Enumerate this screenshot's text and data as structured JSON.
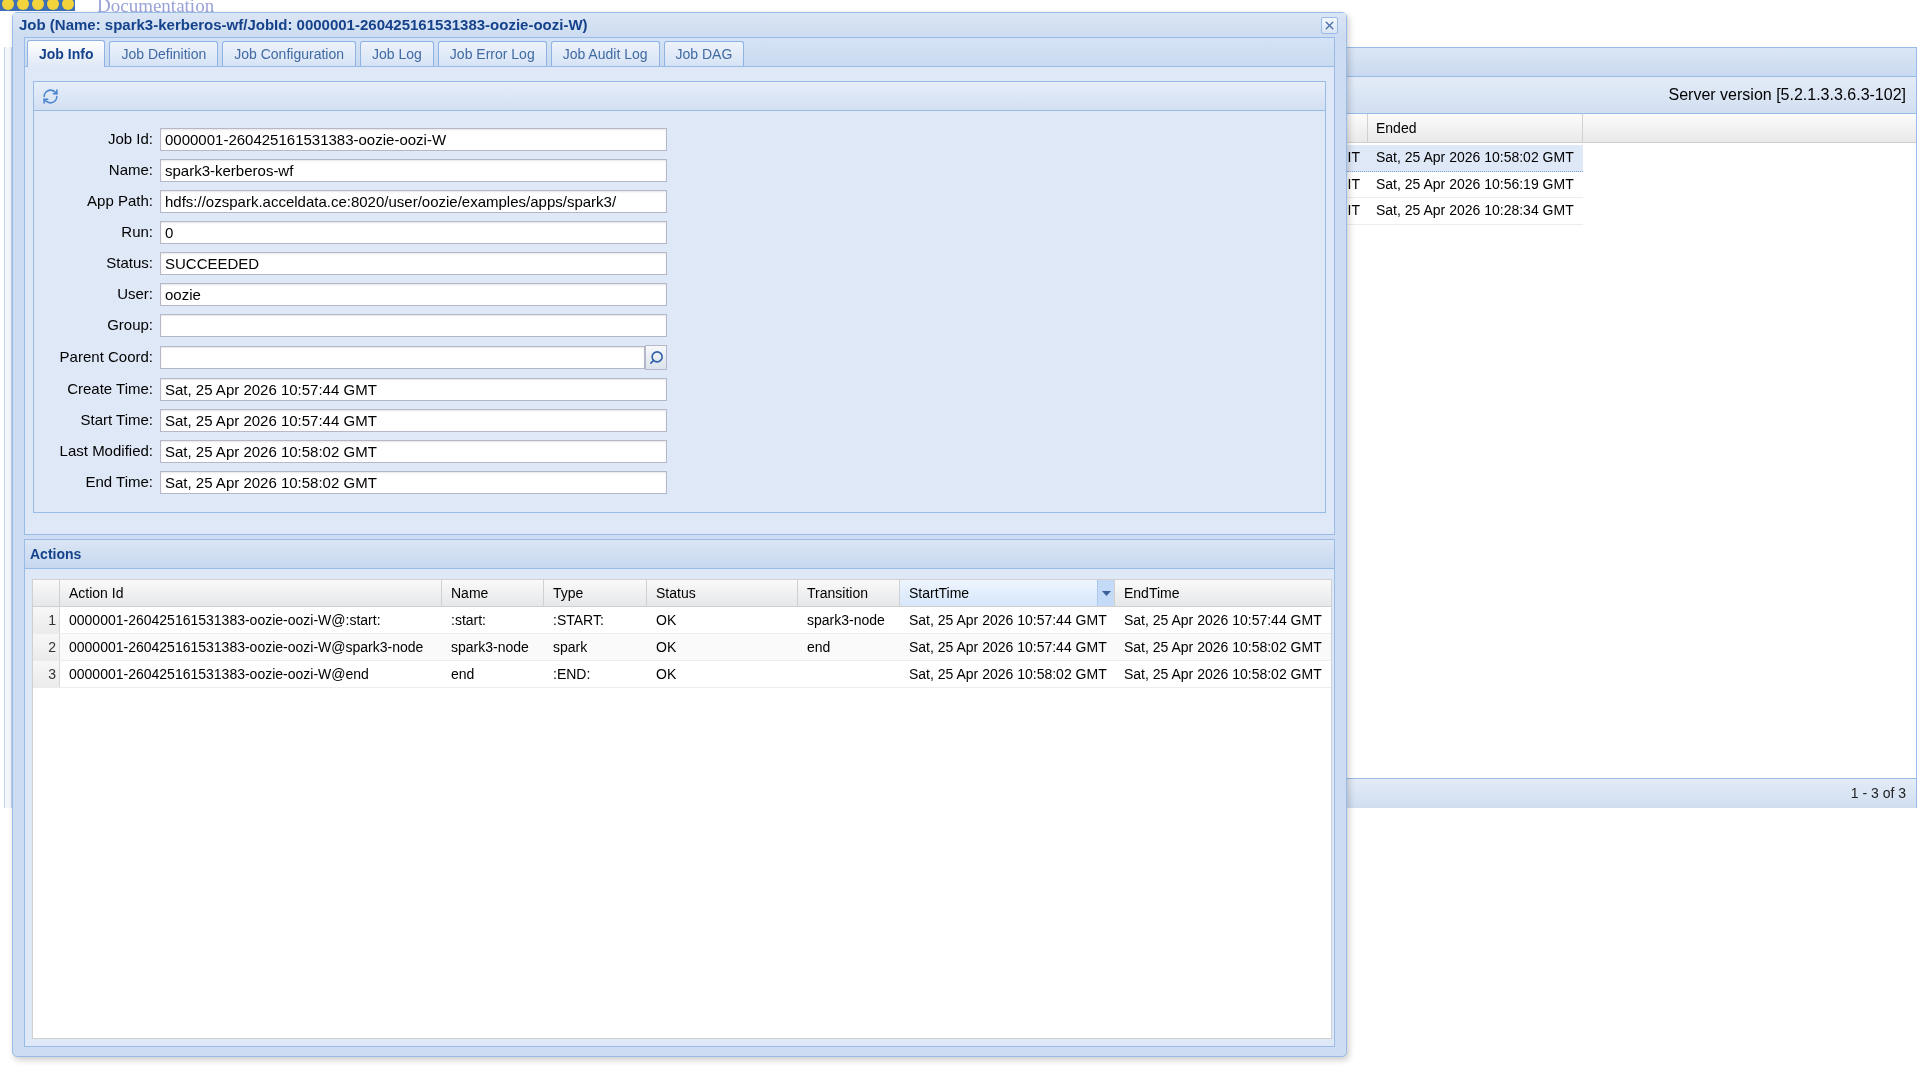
{
  "page_header": {
    "link": "Documentation"
  },
  "background_panel": {
    "server_version": "Server version [5.2.1.3.3.6.3-102]",
    "grid": {
      "ended_column": "Ended",
      "rows": [
        {
          "column_1": "IT",
          "ended": "Sat, 25 Apr 2026 10:58:02 GMT",
          "selected": true
        },
        {
          "column_1": "IT",
          "ended": "Sat, 25 Apr 2026 10:56:19 GMT",
          "selected": false
        },
        {
          "column_1": "IT",
          "ended": "Sat, 25 Apr 2026 10:28:34 GMT",
          "selected": false
        }
      ]
    },
    "paging": "1 - 3 of 3"
  },
  "dialog": {
    "title": "Job (Name: spark3-kerberos-wf/JobId: 0000001-260425161531383-oozie-oozi-W)",
    "tabs": [
      {
        "label": "Job Info",
        "selected": true
      },
      {
        "label": "Job Definition",
        "selected": false
      },
      {
        "label": "Job Configuration",
        "selected": false
      },
      {
        "label": "Job Log",
        "selected": false
      },
      {
        "label": "Job Error Log",
        "selected": false
      },
      {
        "label": "Job Audit Log",
        "selected": false
      },
      {
        "label": "Job DAG",
        "selected": false
      }
    ],
    "job_info": {
      "fields": [
        {
          "label": "Job Id:",
          "value": "0000001-260425161531383-oozie-oozi-W",
          "kind": "text"
        },
        {
          "label": "Name:",
          "value": "spark3-kerberos-wf",
          "kind": "text"
        },
        {
          "label": "App Path:",
          "value": "hdfs://ozspark.acceldata.ce:8020/user/oozie/examples/apps/spark3/",
          "kind": "text"
        },
        {
          "label": "Run:",
          "value": "0",
          "kind": "text"
        },
        {
          "label": "Status:",
          "value": "SUCCEEDED",
          "kind": "text"
        },
        {
          "label": "User:",
          "value": "oozie",
          "kind": "text"
        },
        {
          "label": "Group:",
          "kind": "text"
        },
        {
          "label": "Parent Coord:",
          "kind": "lookup"
        },
        {
          "label": "Create Time:",
          "value": "Sat, 25 Apr 2026 10:57:44 GMT",
          "kind": "text"
        },
        {
          "label": "Start Time:",
          "value": "Sat, 25 Apr 2026 10:57:44 GMT",
          "kind": "text"
        },
        {
          "label": "Last Modified:",
          "value": "Sat, 25 Apr 2026 10:58:02 GMT",
          "kind": "text"
        },
        {
          "label": "End Time:",
          "value": "Sat, 25 Apr 2026 10:58:02 GMT",
          "kind": "text"
        }
      ]
    },
    "actions": {
      "title": "Actions",
      "columns": [
        {
          "label": "Action Id",
          "highlighted": false
        },
        {
          "label": "Name",
          "highlighted": false
        },
        {
          "label": "Type",
          "highlighted": false
        },
        {
          "label": "Status",
          "highlighted": false
        },
        {
          "label": "Transition",
          "highlighted": false
        },
        {
          "label": "StartTime",
          "highlighted": true
        },
        {
          "label": "EndTime",
          "highlighted": false
        }
      ],
      "rows": [
        {
          "number": "1",
          "action_id": "0000001-260425161531383-oozie-oozi-W@:start:",
          "name": ":start:",
          "type": ":START:",
          "status": "OK",
          "transition": "spark3-node",
          "start_time": "Sat, 25 Apr 2026 10:57:44 GMT",
          "end_time": "Sat, 25 Apr 2026 10:57:44 GMT"
        },
        {
          "number": "2",
          "action_id": "0000001-260425161531383-oozie-oozi-W@spark3-node",
          "name": "spark3-node",
          "type": "spark",
          "status": "OK",
          "transition": "end",
          "start_time": "Sat, 25 Apr 2026 10:57:44 GMT",
          "end_time": "Sat, 25 Apr 2026 10:58:02 GMT"
        },
        {
          "number": "3",
          "action_id": "0000001-260425161531383-oozie-oozi-W@end",
          "name": "end",
          "type": ":END:",
          "status": "OK",
          "start_time": "Sat, 25 Apr 2026 10:58:02 GMT",
          "end_time": "Sat, 25 Apr 2026 10:58:02 GMT"
        }
      ]
    }
  }
}
